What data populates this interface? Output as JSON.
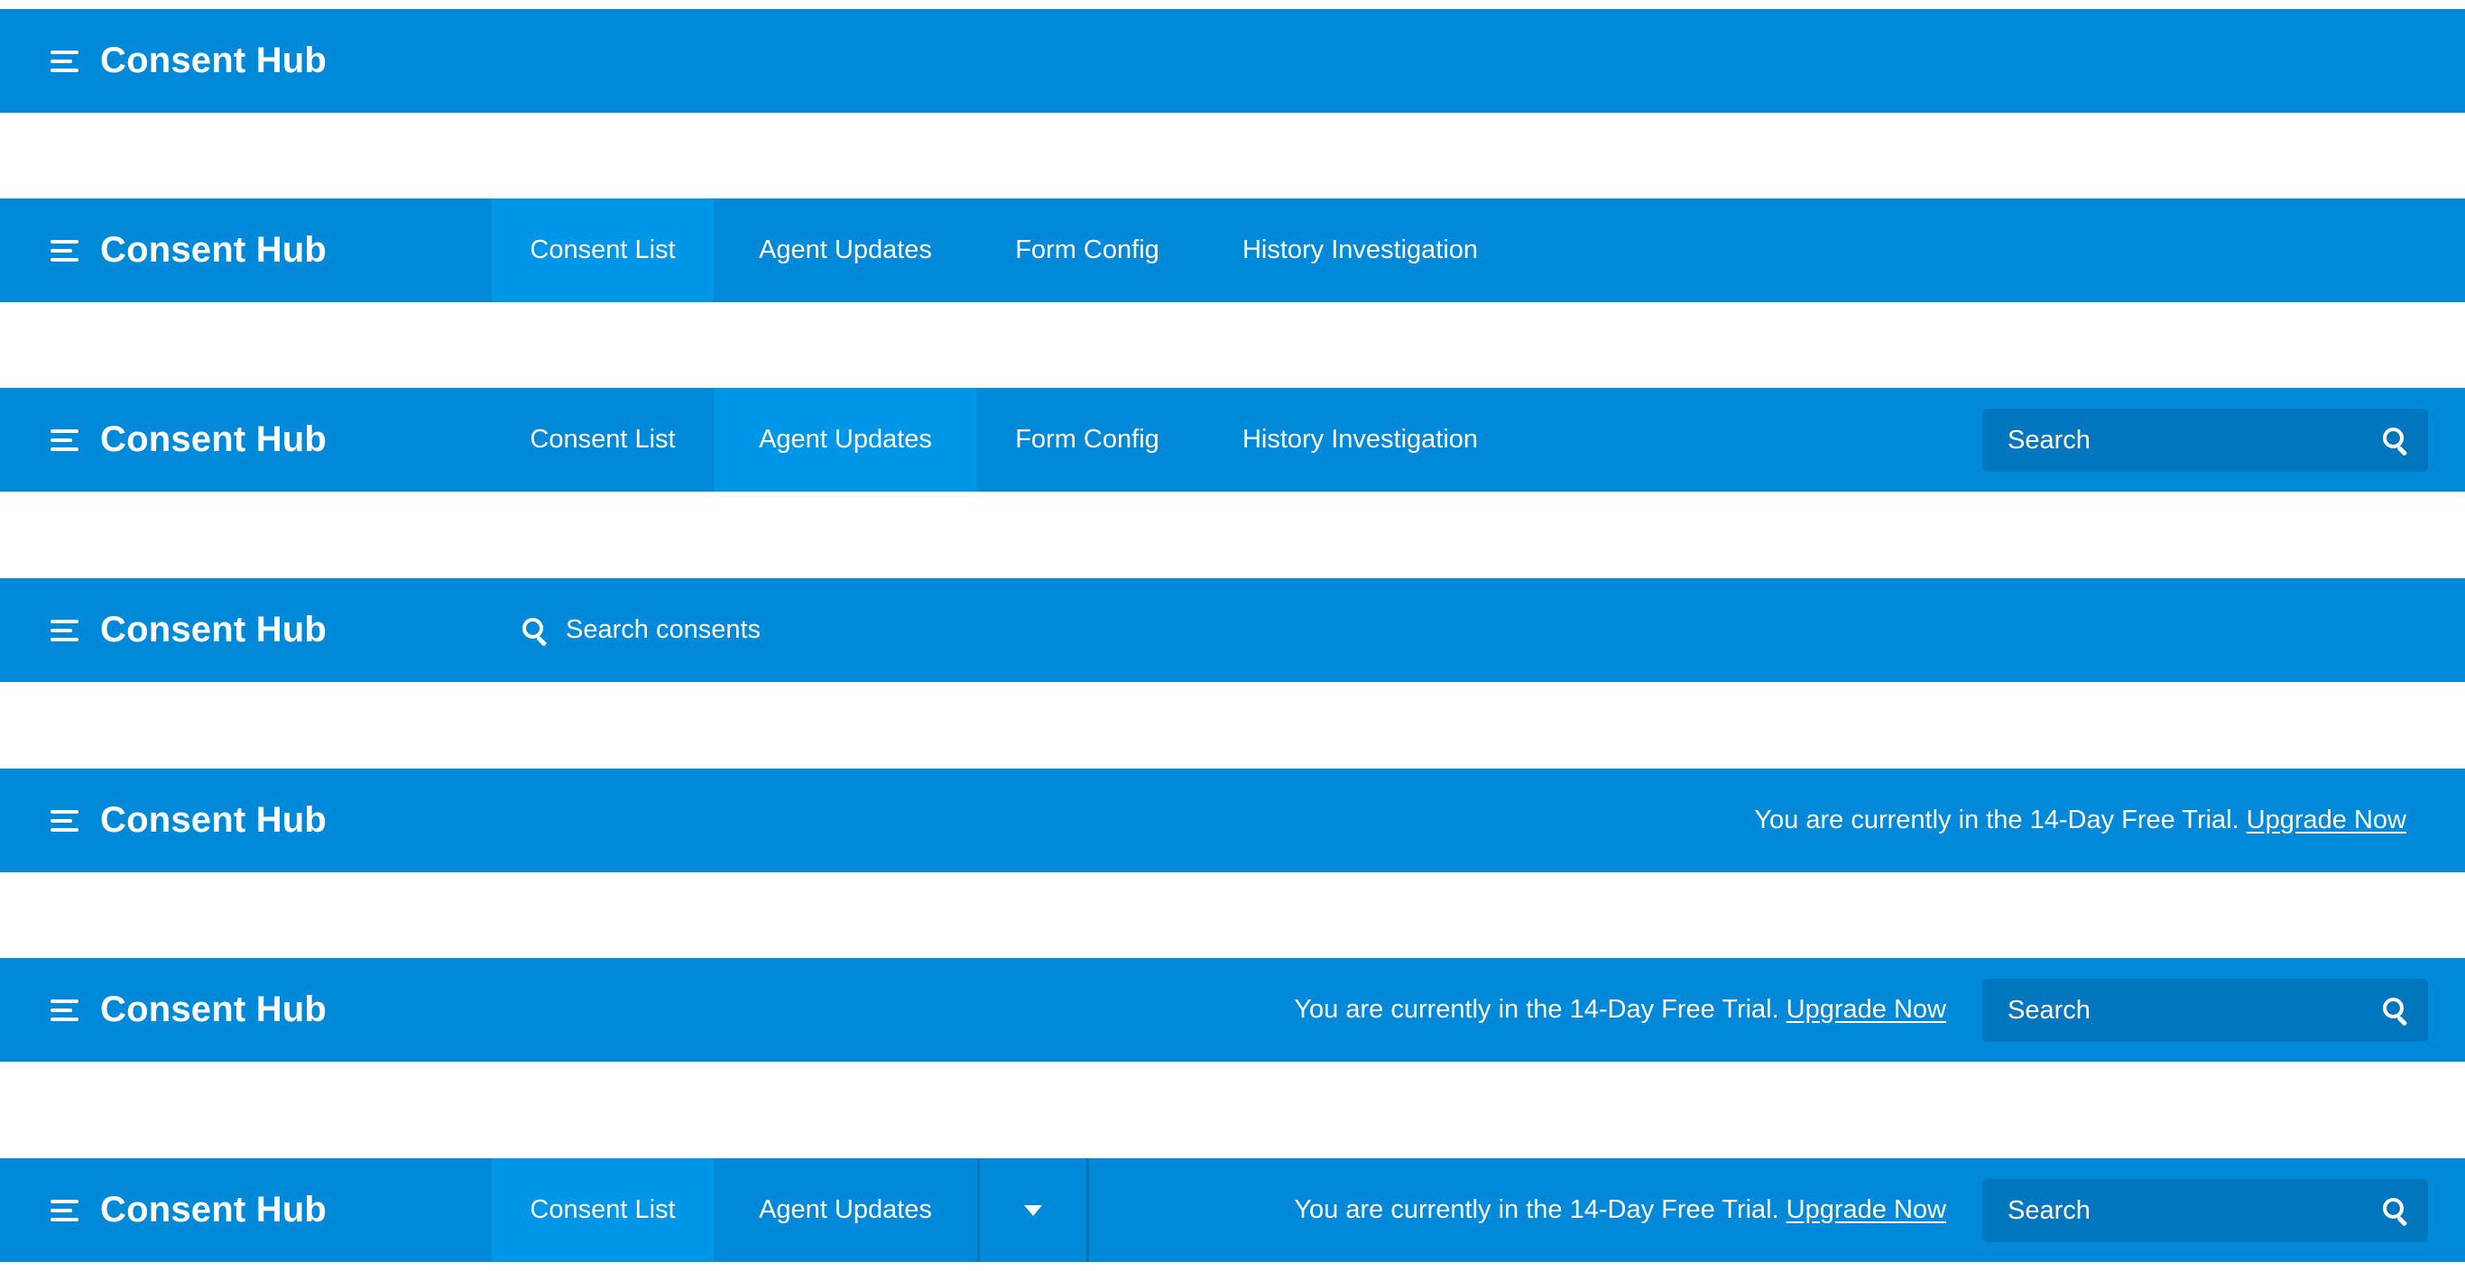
{
  "app": {
    "title": "Consent Hub"
  },
  "nav": {
    "tabs": [
      "Consent List",
      "Agent Updates",
      "Form Config",
      "History Investigation"
    ]
  },
  "search": {
    "placeholder": "Search",
    "inline_placeholder": "Search consents"
  },
  "trial": {
    "message": "You are currently in the 14-Day Free Trial.",
    "link": "Upgrade Now"
  },
  "theme": {
    "bar": "#0089d9",
    "active_tab": "#0096e8",
    "search_bg": "#0076bf",
    "text": "#ffffff"
  },
  "icons": {
    "menu": "hamburger-menu-icon",
    "search": "magnifier-icon",
    "more": "caret-down-icon"
  }
}
